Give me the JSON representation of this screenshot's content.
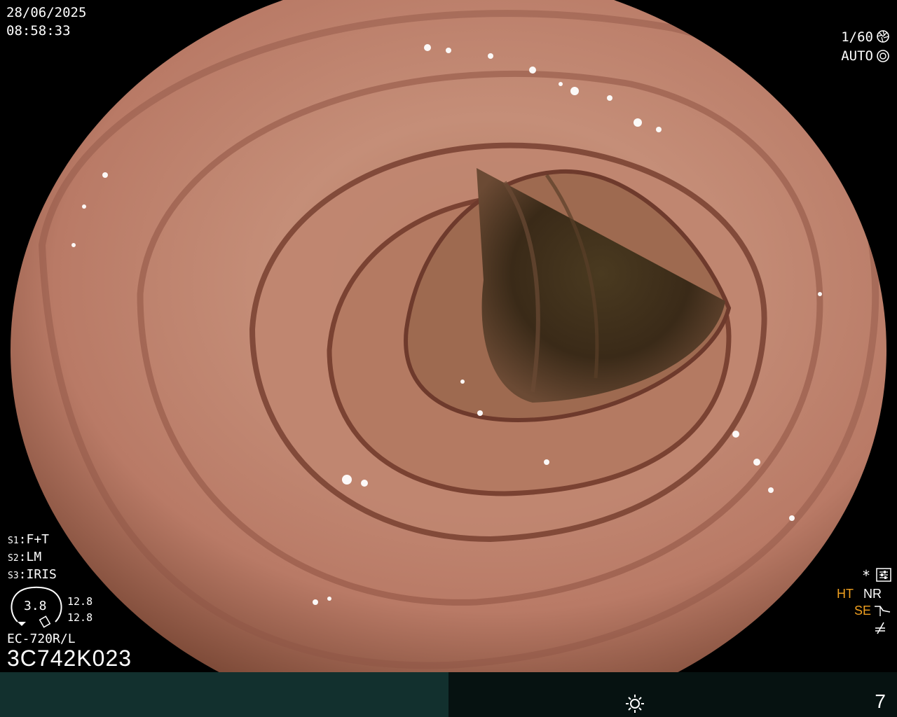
{
  "overlay": {
    "date": "28/06/2025",
    "time": "08:58:33",
    "shutter": "1/60",
    "exposure_mode": "AUTO",
    "switches": [
      {
        "key": "S1",
        "value": "F+T"
      },
      {
        "key": "S2",
        "value": "LM"
      },
      {
        "key": "S3",
        "value": "IRIS"
      }
    ],
    "zoom_value": "3.8",
    "magnification_top": "12.8",
    "magnification_bottom": "12.8",
    "scope_model": "EC-720R/L",
    "serial_number": "3C742K023",
    "star": "*",
    "ht_label": "HT",
    "nr_label": "NR",
    "se_label": "SE",
    "counter": "7"
  },
  "colors": {
    "accent_orange": "#f0a020",
    "bar_left": "#12302e",
    "bar_right": "#061211"
  },
  "icons": [
    "shutter-icon",
    "iris-icon",
    "setting-icon",
    "se-curve-icon",
    "freeze-icon",
    "light-icon"
  ]
}
